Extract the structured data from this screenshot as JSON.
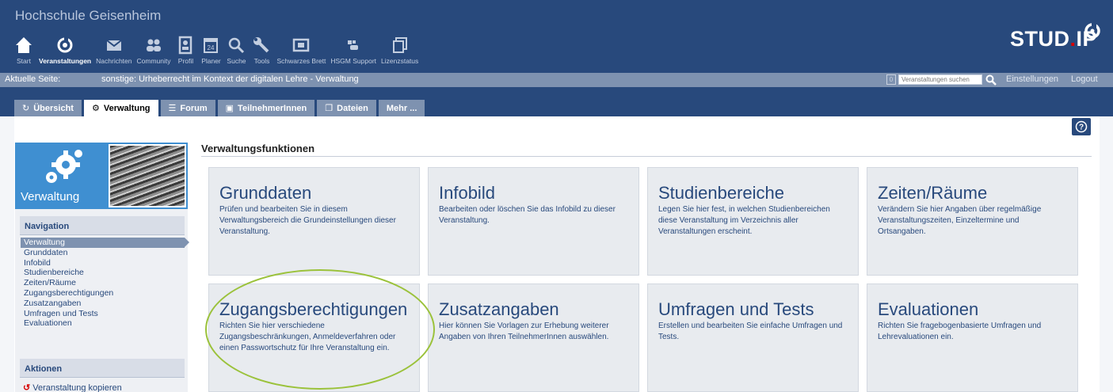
{
  "header": {
    "university": "Hochschule Geisenheim",
    "logo": "STUD.IP",
    "nav": [
      {
        "label": "Start",
        "icon": "home-icon"
      },
      {
        "label": "Veranstaltungen",
        "icon": "courses-icon"
      },
      {
        "label": "Nachrichten",
        "icon": "mail-icon"
      },
      {
        "label": "Community",
        "icon": "community-icon"
      },
      {
        "label": "Profil",
        "icon": "profile-icon"
      },
      {
        "label": "Planer",
        "icon": "calendar-icon"
      },
      {
        "label": "Suche",
        "icon": "search-icon"
      },
      {
        "label": "Tools",
        "icon": "wrench-icon"
      },
      {
        "label": "Schwarzes Brett",
        "icon": "board-icon"
      },
      {
        "label": "HSGM Support",
        "icon": "support-icon"
      },
      {
        "label": "Lizenzstatus",
        "icon": "license-icon"
      }
    ]
  },
  "pagebar": {
    "label": "Aktuelle Seite:",
    "value": "sonstige: Urheberrecht im Kontext der digitalen Lehre - Verwaltung",
    "count": "0",
    "search_placeholder": "Veranstaltungen suchen",
    "settings": "Einstellungen",
    "logout": "Logout"
  },
  "tabs": [
    {
      "label": "Übersicht",
      "icon": "overview-icon"
    },
    {
      "label": "Verwaltung",
      "icon": "admin-icon"
    },
    {
      "label": "Forum",
      "icon": "forum-icon"
    },
    {
      "label": "TeilnehmerInnen",
      "icon": "participants-icon"
    },
    {
      "label": "Dateien",
      "icon": "files-icon"
    },
    {
      "label": "Mehr ..."
    }
  ],
  "sidebar": {
    "title": "Verwaltung",
    "nav_title": "Navigation",
    "nav": [
      "Verwaltung",
      "Grunddaten",
      "Infobild",
      "Studienbereiche",
      "Zeiten/Räume",
      "Zugangsberechtigungen",
      "Zusatzangaben",
      "Umfragen und Tests",
      "Evaluationen"
    ],
    "actions_title": "Aktionen",
    "copy_action": "Veranstaltung kopieren"
  },
  "main": {
    "title": "Verwaltungsfunktionen",
    "tiles": [
      {
        "title": "Grunddaten",
        "desc": "Prüfen und bearbeiten Sie in diesem Verwaltungsbereich die Grundeinstellungen dieser Veranstaltung."
      },
      {
        "title": "Infobild",
        "desc": "Bearbeiten oder löschen Sie das Infobild zu dieser Veranstaltung."
      },
      {
        "title": "Studienbereiche",
        "desc": "Legen Sie hier fest, in welchen Studienbereichen diese Veranstaltung im Verzeichnis aller Veranstaltungen erscheint."
      },
      {
        "title": "Zeiten/Räume",
        "desc": "Verändern Sie hier Angaben über regelmäßige Veranstaltungszeiten, Einzeltermine und Ortsangaben."
      },
      {
        "title": "Zugangsberechtigungen",
        "desc": "Richten Sie hier verschiedene Zugangsbeschränkungen, Anmeldeverfahren oder einen Passwortschutz für Ihre Veranstaltung ein."
      },
      {
        "title": "Zusatzangaben",
        "desc": "Hier können Sie Vorlagen zur Erhebung weiterer Angaben von Ihren TeilnehmerInnen auswählen."
      },
      {
        "title": "Umfragen und Tests",
        "desc": "Erstellen und bearbeiten Sie einfache Umfragen und Tests."
      },
      {
        "title": "Evaluationen",
        "desc": "Richten Sie fragebogenbasierte Umfragen und Lehrevaluationen ein."
      }
    ]
  },
  "colors": {
    "brand": "#28497c",
    "secondary": "#7e92b0",
    "highlight": "#9bc23b",
    "logo_dot": "#d60000"
  }
}
